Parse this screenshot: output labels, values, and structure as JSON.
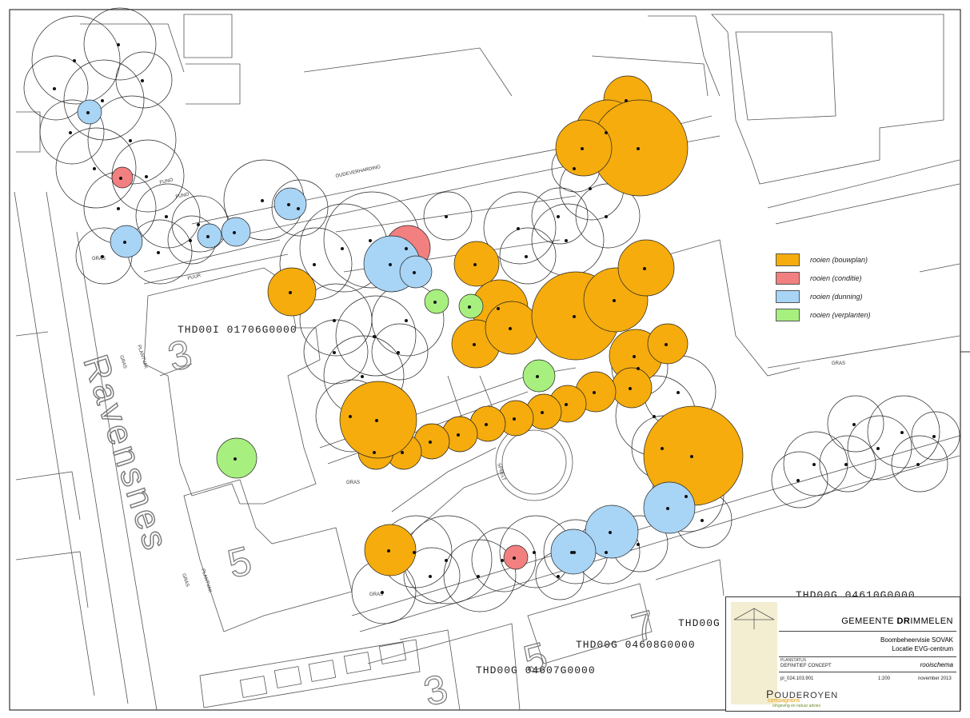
{
  "legend": {
    "items": [
      {
        "label": "rooien (bouwplan)",
        "color": "#f5ac0c"
      },
      {
        "label": "rooien (conditie)",
        "color": "#f28080"
      },
      {
        "label": "rooien (dunning)",
        "color": "#a8d4f5"
      },
      {
        "label": "rooien (verplanten)",
        "color": "#a7ef7f"
      }
    ]
  },
  "parcels": {
    "p1": "THD00I 01706G0000",
    "p2": "THD00G 04608G0000",
    "p3": "THD00G 04607G0000",
    "p4": "THD00G 04",
    "p5": "THD00G 04610G0000"
  },
  "street": "Ravensnes",
  "labels": {
    "oudeverharding": "OUDEVERHARDING",
    "funo1": "FUNO",
    "funo2": "FUNO",
    "gras1": "GRAS",
    "gras2": "GRAS",
    "gras3": "GRAS",
    "gras4": "GRAS",
    "gras5": "GRAS",
    "plantvak1": "PLANTVAK",
    "plantvak2": "PLANTVAK",
    "speelt": "SPEELT",
    "puur": "PUUR",
    "gras6": "GRAS"
  },
  "titleblock": {
    "client_prefix": "GEMEENTE ",
    "client_bold": "DR",
    "client_rest": "IMMELEN",
    "project_line1": "Boombeheervisie SOVAK",
    "project_line2": "Locatie EVG-centrum",
    "status_label": "PLANSTATUS",
    "status_value": "DEFINITIEF CONCEPT",
    "sheet_title": "rooischema",
    "number": "pl_024.103.901",
    "scale": "1:200",
    "date": "november 2013",
    "brand_prefix": "P",
    "brand_main": "OUDEROYEN",
    "brand_sub": "compagnons",
    "tagline": "omgeving en natuur advies"
  }
}
